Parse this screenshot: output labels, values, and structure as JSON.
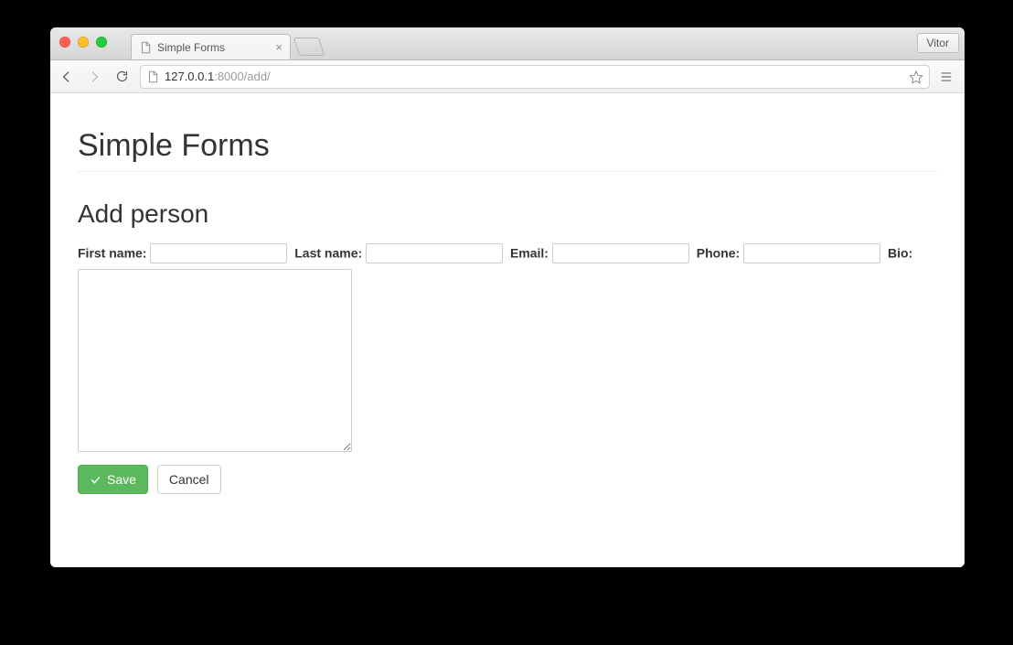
{
  "browser": {
    "tab_title": "Simple Forms",
    "user_label": "Vitor",
    "url_host": "127.0.0.1",
    "url_port_path": ":8000/add/"
  },
  "page": {
    "title": "Simple Forms",
    "section_title": "Add person"
  },
  "form": {
    "first_name": {
      "label": "First name:",
      "value": ""
    },
    "last_name": {
      "label": "Last name:",
      "value": ""
    },
    "email": {
      "label": "Email:",
      "value": ""
    },
    "phone": {
      "label": "Phone:",
      "value": ""
    },
    "bio": {
      "label": "Bio:",
      "value": ""
    }
  },
  "buttons": {
    "save": "Save",
    "cancel": "Cancel"
  }
}
